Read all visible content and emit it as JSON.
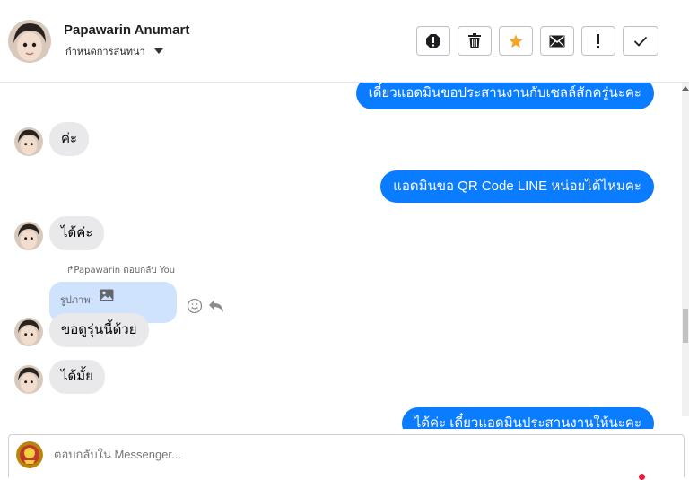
{
  "header": {
    "name": "Papawarin Anumart",
    "assign_label": "กำหนดการสนทนา",
    "actions": [
      {
        "icon": "alert-circle-icon",
        "label": "spam"
      },
      {
        "icon": "trash-icon",
        "label": "delete"
      },
      {
        "icon": "star-icon",
        "label": "star"
      },
      {
        "icon": "envelope-icon",
        "label": "mark-unread"
      },
      {
        "icon": "exclamation-icon",
        "label": "follow-up"
      },
      {
        "icon": "check-icon",
        "label": "done"
      }
    ]
  },
  "messages": {
    "out_1": "เดี๋ยวแอดมินขอประสานงานกับเซลล์สักครู่นะคะ",
    "in_1": "ค่ะ",
    "out_2": "แอดมินขอ QR Code LINE หน่อยได้ไหมคะ",
    "in_2": "ได้ค่ะ",
    "reply_note": "Papawarin ตอบกลับ You",
    "reply_quote": "รูปภาพ",
    "in_3": "ขอดูรุ่นนี้ด้วย",
    "in_4": "ได้มั้ย",
    "out_3": "ได้ค่ะ เดี๋ยวแอดมินประสานงานให้นะคะ"
  },
  "composer": {
    "placeholder": "ตอบกลับใน Messenger..."
  },
  "colors": {
    "outgoing": "#0a7cff",
    "incoming": "#e9e9eb",
    "reply": "#cfe3ff",
    "star": "#f5a623"
  }
}
